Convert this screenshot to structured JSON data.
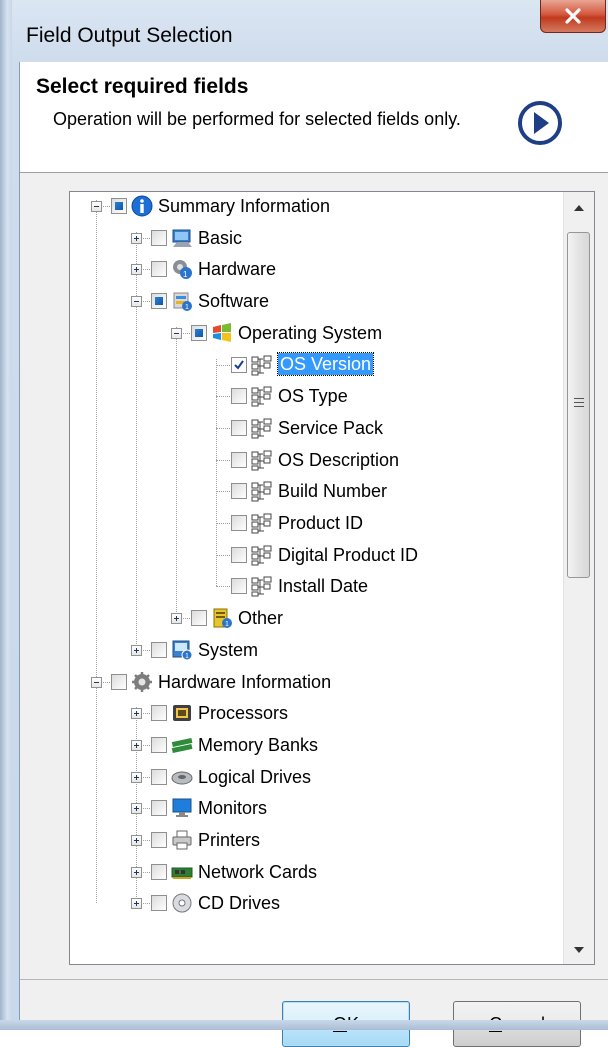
{
  "window": {
    "title": "Field Output Selection",
    "close_icon": "close-icon"
  },
  "header": {
    "title": "Select required fields",
    "description": "Operation will be performed for selected fields only.",
    "next_icon": "arrow-right-circle-icon"
  },
  "tree": {
    "items": [
      {
        "label": "Summary Information",
        "level": 0,
        "expander": "minus",
        "check": "partial",
        "icon": "info-icon"
      },
      {
        "label": "Basic",
        "level": 1,
        "expander": "plus",
        "check": "unchecked",
        "icon": "computer-icon"
      },
      {
        "label": "Hardware",
        "level": 1,
        "expander": "plus",
        "check": "unchecked",
        "icon": "hardware-gears-icon"
      },
      {
        "label": "Software",
        "level": 1,
        "expander": "minus",
        "check": "partial",
        "icon": "software-icon"
      },
      {
        "label": "Operating System",
        "level": 2,
        "expander": "minus",
        "check": "partial",
        "icon": "windows-logo-icon"
      },
      {
        "label": "OS Version",
        "level": 3,
        "check": "checked",
        "icon": "field-tree-icon",
        "selected": true
      },
      {
        "label": "OS Type",
        "level": 3,
        "check": "unchecked",
        "icon": "field-tree-icon"
      },
      {
        "label": "Service Pack",
        "level": 3,
        "check": "unchecked",
        "icon": "field-tree-icon"
      },
      {
        "label": "OS Description",
        "level": 3,
        "check": "unchecked",
        "icon": "field-tree-icon"
      },
      {
        "label": "Build Number",
        "level": 3,
        "check": "unchecked",
        "icon": "field-tree-icon"
      },
      {
        "label": "Product ID",
        "level": 3,
        "check": "unchecked",
        "icon": "field-tree-icon"
      },
      {
        "label": "Digital Product ID",
        "level": 3,
        "check": "unchecked",
        "icon": "field-tree-icon"
      },
      {
        "label": "Install Date",
        "level": 3,
        "check": "unchecked",
        "icon": "field-tree-icon"
      },
      {
        "label": "Other",
        "level": 2,
        "expander": "plus",
        "check": "unchecked",
        "icon": "other-icon"
      },
      {
        "label": "System",
        "level": 1,
        "expander": "plus",
        "check": "unchecked",
        "icon": "system-icon"
      },
      {
        "label": "Hardware Information",
        "level": 0,
        "expander": "minus",
        "check": "unchecked",
        "icon": "gears-icon"
      },
      {
        "label": "Processors",
        "level": 1,
        "expander": "plus",
        "check": "unchecked",
        "icon": "processor-icon"
      },
      {
        "label": "Memory Banks",
        "level": 1,
        "expander": "plus",
        "check": "unchecked",
        "icon": "memory-icon"
      },
      {
        "label": "Logical Drives",
        "level": 1,
        "expander": "plus",
        "check": "unchecked",
        "icon": "drive-icon"
      },
      {
        "label": "Monitors",
        "level": 1,
        "expander": "plus",
        "check": "unchecked",
        "icon": "monitor-icon"
      },
      {
        "label": "Printers",
        "level": 1,
        "expander": "plus",
        "check": "unchecked",
        "icon": "printer-icon"
      },
      {
        "label": "Network Cards",
        "level": 1,
        "expander": "plus",
        "check": "unchecked",
        "icon": "network-card-icon"
      },
      {
        "label": "CD Drives",
        "level": 1,
        "expander": "plus",
        "check": "unchecked",
        "icon": "cd-drive-icon"
      }
    ]
  },
  "scrollbar": {
    "up_icon": "scroll-up-icon",
    "down_icon": "scroll-down-icon"
  },
  "buttons": {
    "ok": {
      "label": "OK",
      "mnemonic": "O"
    },
    "cancel": {
      "label": "Cancel",
      "mnemonic": "C"
    }
  },
  "colors": {
    "selection": "#3399ff",
    "accent": "#1e4fa3",
    "close": "#c0391e"
  }
}
